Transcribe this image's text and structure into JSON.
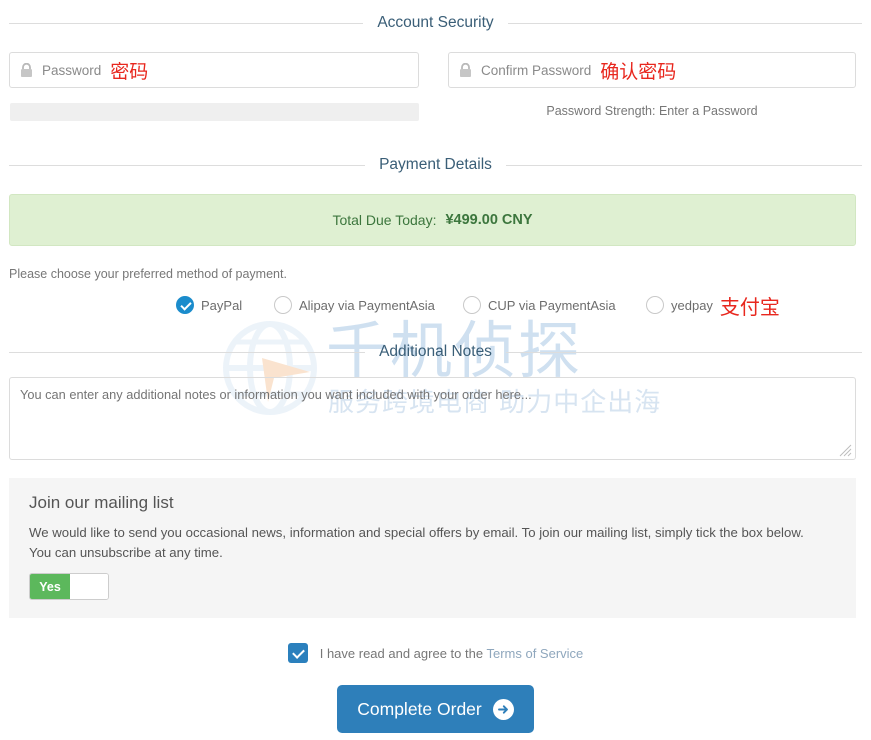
{
  "sections": {
    "account_security": "Account Security",
    "payment_details": "Payment Details",
    "additional_notes": "Additional Notes"
  },
  "account_security": {
    "password": {
      "label": "Password",
      "annotation_cn": "密码",
      "icon": "lock-icon",
      "value": ""
    },
    "confirm_password": {
      "label": "Confirm Password",
      "annotation_cn": "确认密码",
      "icon": "lock-icon",
      "value": ""
    },
    "strength_text": "Password Strength: Enter a Password"
  },
  "payment": {
    "total_label": "Total Due Today:",
    "total_amount": "¥499.00 CNY",
    "choose_text": "Please choose your preferred method of payment.",
    "methods": [
      {
        "label": "PayPal",
        "selected": true,
        "annotation_cn": ""
      },
      {
        "label": "Alipay via PaymentAsia",
        "selected": false,
        "annotation_cn": ""
      },
      {
        "label": "CUP via PaymentAsia",
        "selected": false,
        "annotation_cn": ""
      },
      {
        "label": "yedpay",
        "selected": false,
        "annotation_cn": "支付宝"
      }
    ]
  },
  "notes": {
    "placeholder": "You can enter any additional notes or information you want included with your order here...",
    "value": ""
  },
  "mailing_list": {
    "title": "Join our mailing list",
    "body": "We would like to send you occasional news, information and special offers by email. To join our mailing list, simply tick the box below. You can unsubscribe at any time.",
    "toggle_on_label": "Yes",
    "toggle_state": "on"
  },
  "terms": {
    "checked": true,
    "text_before": "I have read and agree to the",
    "link_text": "Terms of Service"
  },
  "submit": {
    "label": "Complete Order",
    "icon": "arrow-right-circle-icon"
  },
  "watermark": {
    "title": "千机侦探",
    "subtitle": "服务跨境电商 助力中企出海",
    "logo_icon": "globe-arrow-logo"
  },
  "colors": {
    "section_heading": "#3a5e77",
    "annotation_red": "#e8271e",
    "banner_bg": "#dff0d2",
    "banner_text": "#3c763d",
    "radio_selected": "#1b8ccc",
    "toggle_on": "#5cb85c",
    "submit_bg": "#2e7fba",
    "checkbox_bg": "#2b80bd",
    "watermark": "#cfe0f0"
  }
}
